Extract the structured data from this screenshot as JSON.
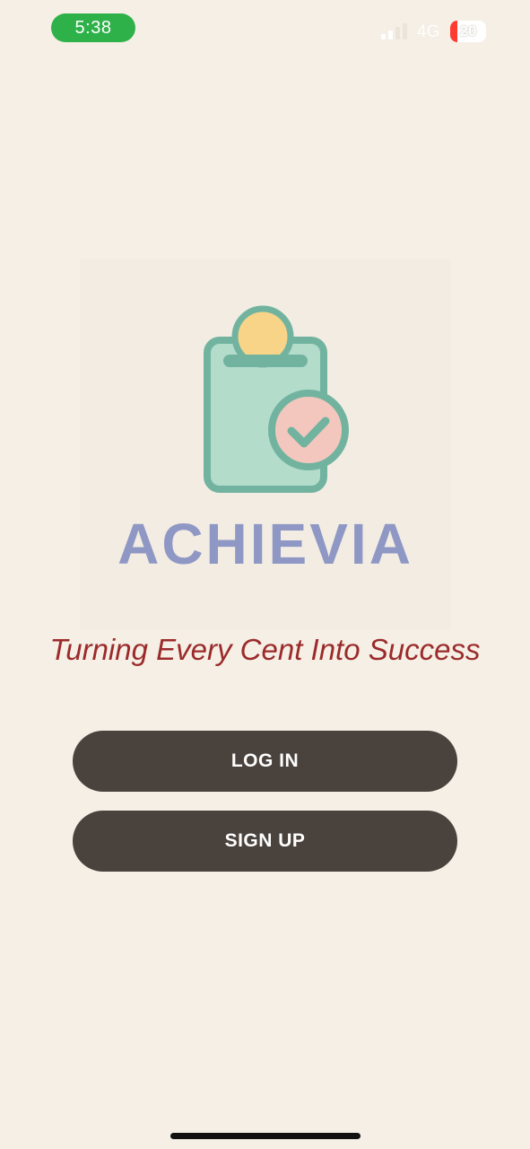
{
  "status_bar": {
    "time": "5:38",
    "network": "4G",
    "battery_level": "20",
    "battery_fraction": 0.2,
    "icons": [
      "signal-icon",
      "battery-icon"
    ],
    "colors": {
      "time_pill": "#2fb14a",
      "battery_low": "#ff3b30"
    }
  },
  "brand": {
    "name": "ACHIEVIA",
    "tagline": "Turning Every Cent Into Success",
    "logo_icon": "clipboard-coin-check-icon",
    "colors": {
      "name": "#8f98c4",
      "tagline": "#9b2b2b",
      "clipboard_fill": "#b3dccb",
      "clipboard_outline": "#72b3a0",
      "coin": "#f7d488",
      "check_badge": "#f3c7bd"
    }
  },
  "actions": {
    "login_label": "LOG IN",
    "signup_label": "SIGN UP",
    "button_color": "#4a423d"
  },
  "theme": {
    "background": "#f5efe5"
  }
}
